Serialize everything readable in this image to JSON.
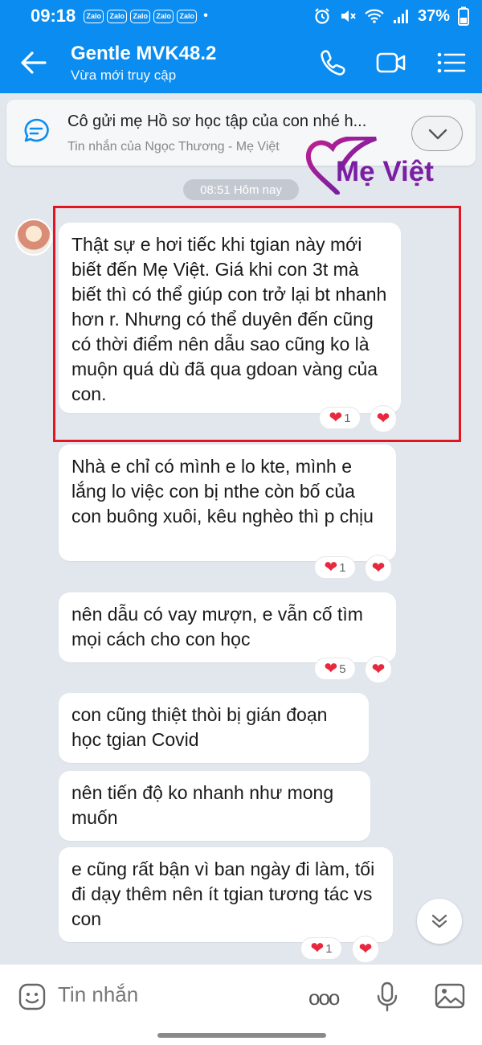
{
  "status_bar": {
    "time": "09:18",
    "notif_icons": [
      "Zalo",
      "Zalo",
      "Zalo",
      "Zalo",
      "Zalo"
    ],
    "dot": "•",
    "battery": "37%"
  },
  "header": {
    "title": "Gentle MVK48.2",
    "subtitle": "Vừa mới truy cập"
  },
  "pinned": {
    "text": "Cô gửi mẹ Hồ sơ học tập của con nhé h...",
    "sender": "Tin nhắn của Ngọc Thương - Mẹ Việt"
  },
  "watermark": {
    "text": "Mẹ Việt"
  },
  "chat": {
    "timestamp": "08:51 Hôm nay",
    "messages": [
      {
        "text": "Thật sự e hơi tiếc khi tgian này mới biết đến Mẹ Việt. Giá khi con 3t mà biết thì có thể giúp con trở lại bt nhanh hơn r. Nhưng có thể duyên đến cũng có thời điểm nên dẫu sao cũng ko là muộn quá dù đã qua gdoan vàng của con.",
        "reaction_count": "1"
      },
      {
        "text": "Nhà e chỉ có mình e lo kte, mình e lắng lo việc con bị nthe còn bố của con buông xuôi, kêu nghèo thì p chịu",
        "reaction_count": "1"
      },
      {
        "text": "nên dẫu có vay mượn, e vẫn cố tìm mọi cách cho con học",
        "reaction_count": "5"
      },
      {
        "text": "con cũng thiệt thòi bị gián đoạn học tgian Covid"
      },
      {
        "text": "nên tiến độ ko nhanh như mong muốn"
      },
      {
        "text": "e cũng rất bận vì ban ngày đi làm, tối đi dạy thêm nên ít tgian tương tác vs con",
        "reaction_count": "1"
      }
    ]
  },
  "composer": {
    "placeholder": "Tin nhắn",
    "more": "ooo"
  },
  "icons": {
    "heart": "❤",
    "back": "arrow-left-icon",
    "call": "phone-icon",
    "video": "video-icon",
    "menu": "menu-icon",
    "sticker": "sticker-icon",
    "mic": "mic-icon",
    "image": "image-icon"
  },
  "colors": {
    "brand": "#0a8cf0",
    "heart": "#e8283c",
    "highlight": "#e3161f",
    "watermark": "#7b1ea2"
  }
}
